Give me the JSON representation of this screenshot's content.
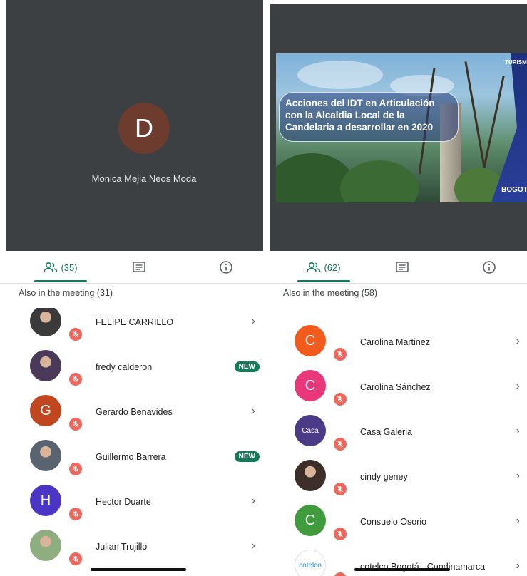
{
  "left_panel": {
    "presenter": {
      "initial": "D",
      "name": "Monica Mejia Neos Moda",
      "avatar_color": "#6d3c2f"
    },
    "tabs": {
      "people_count": "(35)"
    },
    "section_title": "Also in the meeting (31)",
    "participants": [
      {
        "name": "FELIPE CARRILLO",
        "avatar": "photo",
        "initial": "",
        "color": "#3a3a3a",
        "action": "chevron"
      },
      {
        "name": "fredy calderon",
        "avatar": "photo",
        "initial": "",
        "color": "#4a3a5a",
        "action": "badge",
        "badge": "NEW"
      },
      {
        "name": "Gerardo Benavides",
        "avatar": "letter",
        "initial": "G",
        "color": "#c0461f",
        "action": "chevron"
      },
      {
        "name": "Guillermo Barrera",
        "avatar": "photo",
        "initial": "",
        "color": "#5a6470",
        "action": "badge",
        "badge": "NEW"
      },
      {
        "name": "Hector Duarte",
        "avatar": "letter",
        "initial": "H",
        "color": "#4b35c4",
        "action": "chevron"
      },
      {
        "name": "Julian Trujillo",
        "avatar": "photo",
        "initial": "",
        "color": "#8fae7f",
        "action": "chevron"
      }
    ]
  },
  "right_panel": {
    "slide": {
      "title_lines": [
        "Acciones del IDT en Articulación",
        "con la Alcaldia Local de la",
        "Candelaria a desarrollar en 2020"
      ],
      "logo_top": "TURISMO",
      "logo_bottom": "BOGOTÁ"
    },
    "tabs": {
      "people_count": "(62)"
    },
    "section_title": "Also in the meeting (58)",
    "participants": [
      {
        "name": "Carolina Martinez",
        "avatar": "letter",
        "initial": "C",
        "color": "#f35b1c",
        "action": "chevron"
      },
      {
        "name": "Carolina Sánchez",
        "avatar": "letter",
        "initial": "C",
        "color": "#e8377a",
        "action": "chevron"
      },
      {
        "name": "Casa Galeria",
        "avatar": "logo",
        "initial": "Casa",
        "color": "#4b3a86",
        "action": "chevron"
      },
      {
        "name": "cindy geney",
        "avatar": "photo",
        "initial": "",
        "color": "#3e2e2a",
        "action": "chevron"
      },
      {
        "name": "Consuelo Osorio",
        "avatar": "letter",
        "initial": "C",
        "color": "#3f9b3b",
        "action": "chevron"
      },
      {
        "name": "cotelco Bogotá - Cundinamarca",
        "avatar": "logo",
        "initial": "cotelco",
        "color": "#ffffff",
        "action": "chevron"
      }
    ]
  },
  "colors": {
    "accent": "#137a5a",
    "mute": "#ee675c",
    "video_bg": "#3c4043"
  },
  "icons": [
    "people-icon",
    "chat-icon",
    "info-icon",
    "mic-off-icon",
    "chevron-right-icon"
  ]
}
